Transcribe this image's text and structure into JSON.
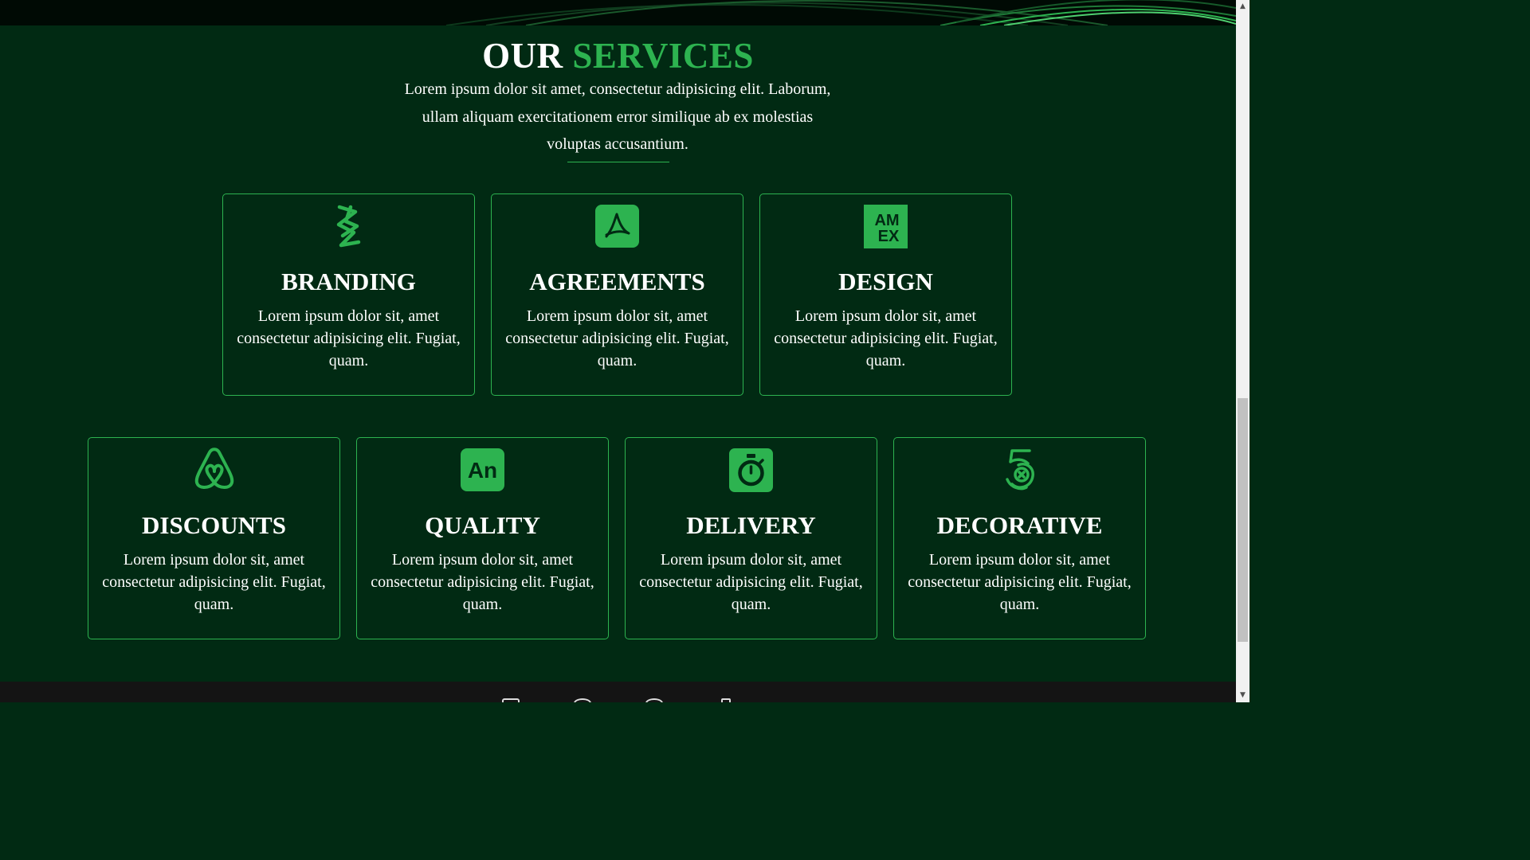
{
  "services": {
    "title_main": "OUR",
    "title_accent": "SERVICES",
    "intro": "Lorem ipsum dolor sit amet, consectetur adipisicing elit. Laborum, ullam aliquam exercitationem error similique ab ex molestias voluptas accusantium.",
    "cards": [
      {
        "title": "BRANDING",
        "text": "Lorem ipsum dolor sit, amet consectetur adipisicing elit. Fugiat, quam.",
        "icon": "confluence-icon"
      },
      {
        "title": "AGREEMENTS",
        "text": "Lorem ipsum dolor sit, amet consectetur adipisicing elit. Fugiat, quam.",
        "icon": "acrobat-pdf-icon"
      },
      {
        "title": "DESIGN",
        "text": "Lorem ipsum dolor sit, amet consectetur adipisicing elit. Fugiat, quam.",
        "icon": "amex-icon"
      },
      {
        "title": "DISCOUNTS",
        "text": "Lorem ipsum dolor sit, amet consectetur adipisicing elit. Fugiat, quam.",
        "icon": "airbnb-icon"
      },
      {
        "title": "QUALITY",
        "text": "Lorem ipsum dolor sit, amet consectetur adipisicing elit. Fugiat, quam.",
        "icon": "adobe-animate-icon"
      },
      {
        "title": "DELIVERY",
        "text": "Lorem ipsum dolor sit, amet consectetur adipisicing elit. Fugiat, quam.",
        "icon": "stopwatch-icon"
      },
      {
        "title": "DECORATIVE",
        "text": "Lorem ipsum dolor sit, amet consectetur adipisicing elit. Fugiat, quam.",
        "icon": "500px-icon"
      }
    ],
    "icon_texts": {
      "amex_top": "AM",
      "amex_bottom": "EX",
      "animate": "An"
    }
  },
  "colors": {
    "background": "#012a13",
    "accent": "#2db350",
    "text": "#ffffff",
    "footer": "#141414",
    "top_band": "#000a04"
  }
}
